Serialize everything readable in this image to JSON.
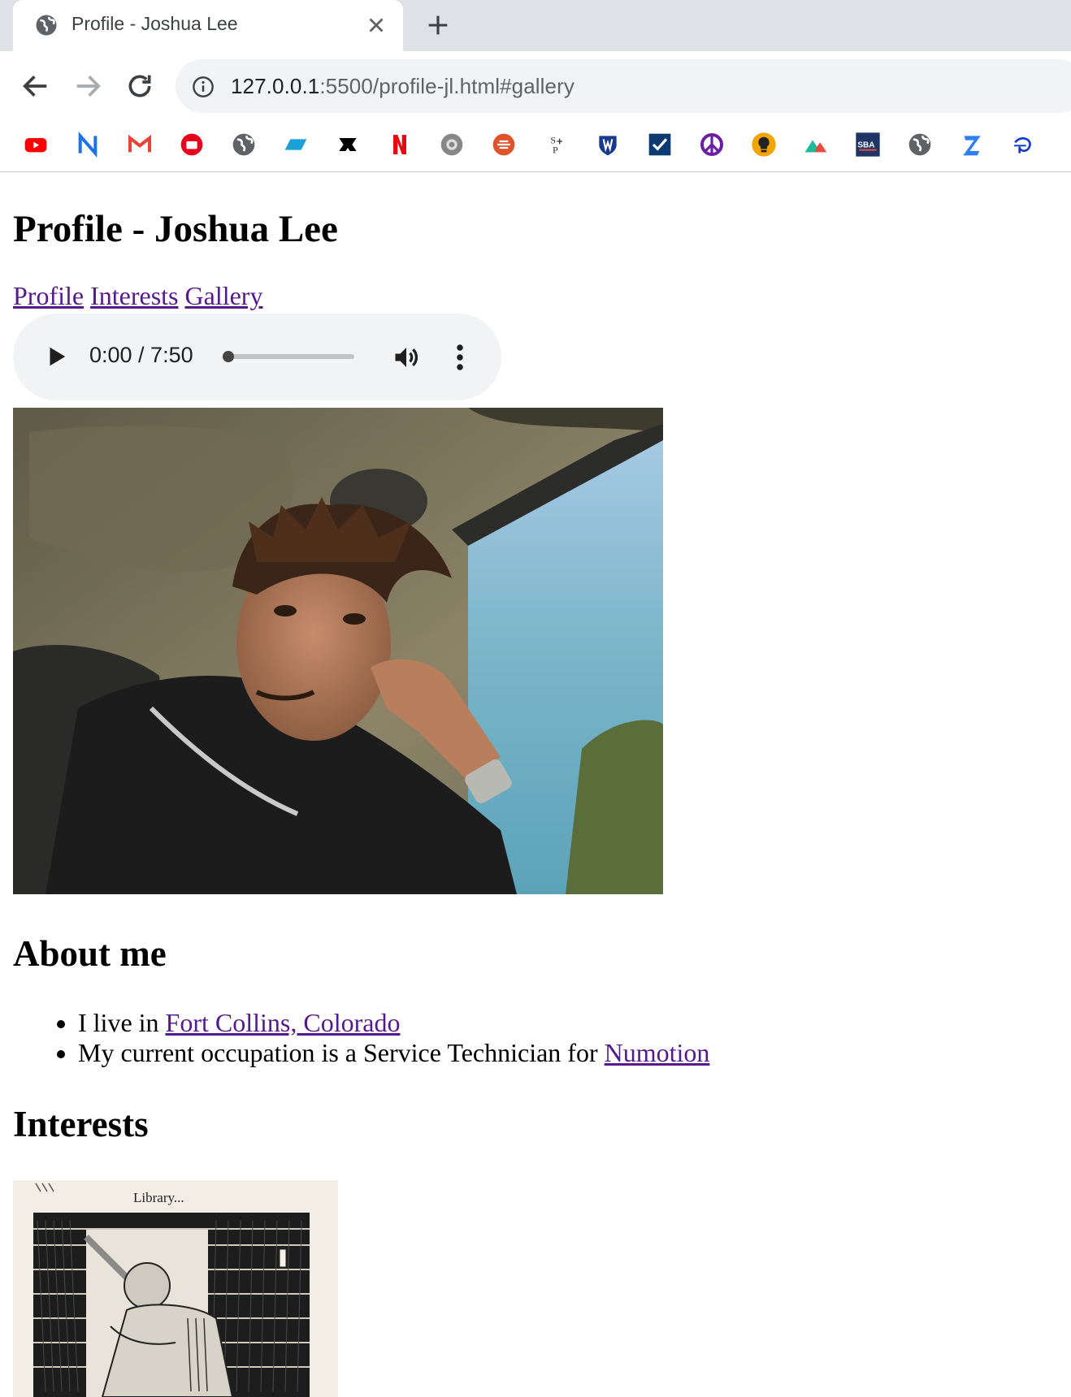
{
  "browser": {
    "tab": {
      "title": "Profile - Joshua Lee"
    },
    "address": {
      "host": "127.0.0.1",
      "rest": ":5500/profile-jl.html#gallery"
    },
    "bookmarks": [
      {
        "icon": "youtube-icon",
        "color": "#ff0000"
      },
      {
        "icon": "n-icon",
        "color": "#1a73e8"
      },
      {
        "icon": "gmail-icon",
        "color": "#ea4335"
      },
      {
        "icon": "red-circle-icon",
        "color": "#e8001d"
      },
      {
        "icon": "globe-icon",
        "color": "#5f6368"
      },
      {
        "icon": "parallelogram-icon",
        "color": "#1ba1d9"
      },
      {
        "icon": "black-logo-icon",
        "color": "#000000"
      },
      {
        "icon": "netflix-icon",
        "color": "#e50914"
      },
      {
        "icon": "gray-circle-icon",
        "color": "#888888"
      },
      {
        "icon": "orange-circle-icon",
        "color": "#e0522a"
      },
      {
        "icon": "sp-icon",
        "color": "#333333"
      },
      {
        "icon": "shield-icon",
        "color": "#1b3a8c"
      },
      {
        "icon": "checkbox-icon",
        "color": "#0d3a73"
      },
      {
        "icon": "peace-icon",
        "color": "#6a1fa5"
      },
      {
        "icon": "lightbulb-icon",
        "color": "#f0a500"
      },
      {
        "icon": "mountain-icon",
        "color": "#e74c3c"
      },
      {
        "icon": "sba-icon",
        "color": "#1f3566"
      },
      {
        "icon": "globe-icon",
        "color": "#5f6368"
      },
      {
        "icon": "z-icon",
        "color": "#2d7ef7"
      },
      {
        "icon": "disney-icon",
        "color": "#113ccf"
      },
      {
        "icon": "partial-icon",
        "color": "#f28b00"
      }
    ]
  },
  "page": {
    "title": "Profile - Joshua Lee",
    "nav": [
      "Profile",
      "Interests",
      "Gallery"
    ],
    "audio": {
      "time": "0:00 / 7:50",
      "progress": 0.0
    },
    "about": {
      "heading": "About me",
      "items": [
        {
          "prefix": "I live in ",
          "link": "Fort Collins, Colorado"
        },
        {
          "prefix": "My current occupation is a Service Technician for ",
          "link": "Numotion"
        }
      ]
    },
    "interests": {
      "heading": "Interests",
      "art_caption": "Library..."
    }
  }
}
